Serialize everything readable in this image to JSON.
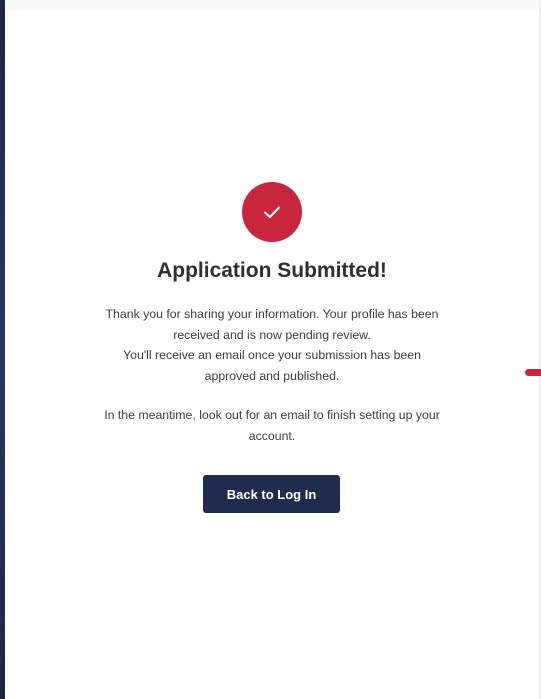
{
  "colors": {
    "accent": "#c8263f",
    "button_bg": "#1f2c4f",
    "title_text": "#2f2f34",
    "body_text": "#3c3c42",
    "left_edge": "#1f2648"
  },
  "status": {
    "icon": "check-icon"
  },
  "content": {
    "title": "Application Submitted!",
    "message_1_line_1": "Thank you for sharing your information. Your profile has been",
    "message_1_line_2": "received and is now pending review.",
    "message_1_line_3": "You'll receive an email once your submission has been",
    "message_1_line_4": "approved and published.",
    "message_2_line_1": "In the meantime, look out for an email to finish setting up your",
    "message_2_line_2": "account."
  },
  "actions": {
    "back_button_label": "Back to Log In"
  }
}
